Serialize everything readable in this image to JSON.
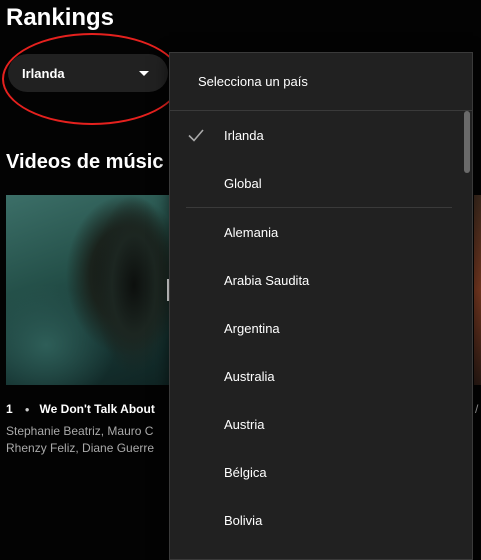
{
  "page": {
    "title": "Rankings"
  },
  "country_selector": {
    "value": "Irlanda",
    "caret_icon": "caret-down-icon"
  },
  "section": {
    "title": "Videos de músic"
  },
  "video": {
    "rank": "1",
    "title": "We Don't Talk About",
    "artists_line1": "Stephanie Beatriz, Mauro C",
    "artists_line2": "Rhenzy Feliz, Diane Guerre",
    "right_edge_text": "/"
  },
  "dropdown": {
    "header": "Selecciona un país",
    "selected_icon": "checkmark-icon",
    "top_items": [
      {
        "label": "Irlanda",
        "selected": true
      },
      {
        "label": "Global",
        "selected": false
      }
    ],
    "countries": [
      {
        "label": "Alemania"
      },
      {
        "label": "Arabia Saudita"
      },
      {
        "label": "Argentina"
      },
      {
        "label": "Australia"
      },
      {
        "label": "Austria"
      },
      {
        "label": "Bélgica"
      },
      {
        "label": "Bolivia"
      }
    ]
  },
  "colors": {
    "background": "#030303",
    "menu": "#212121",
    "annotation": "#e5211e"
  }
}
